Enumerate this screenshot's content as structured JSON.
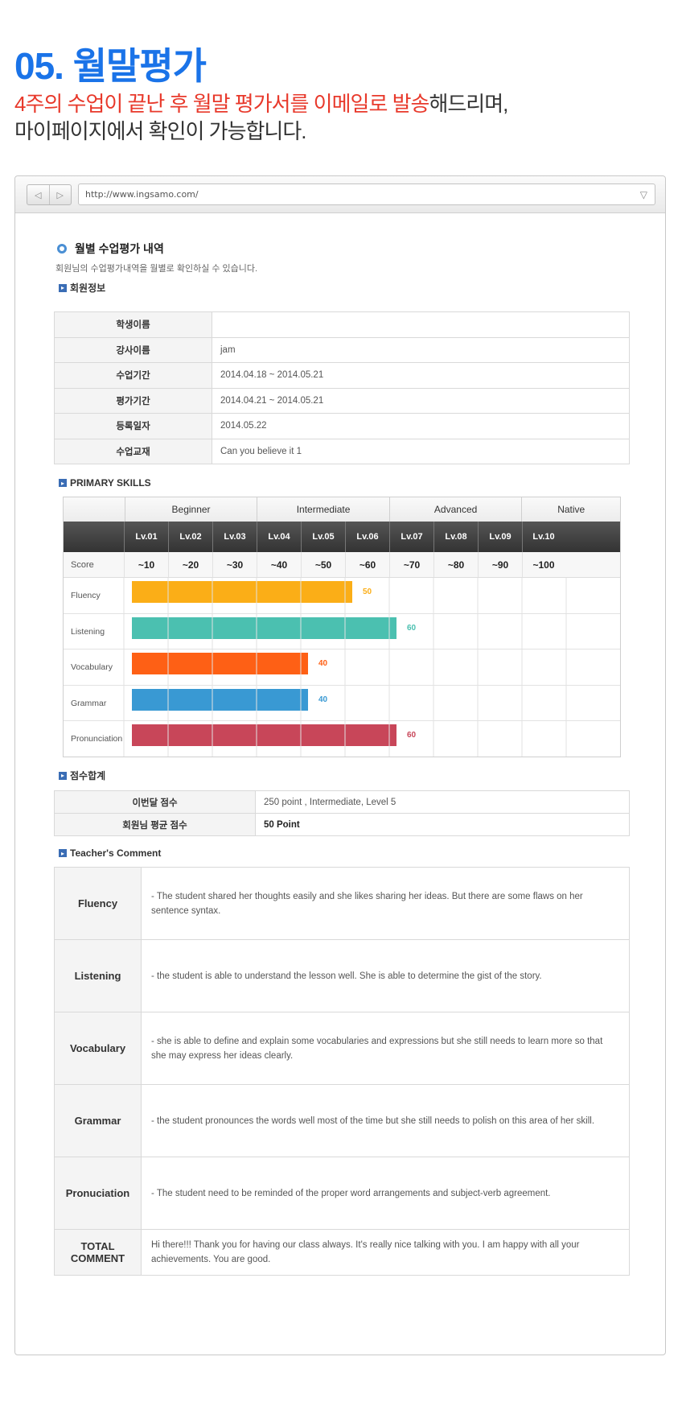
{
  "hero": {
    "title": "05. 월말평가",
    "sub_red": "4주의 수업이 끝난 후 월말 평가서를 이메일로 발송",
    "sub_black1": "해드리며,",
    "sub_black2": "마이페이지에서 확인이 가능합니다."
  },
  "browser": {
    "url": "http://www.ingsamo.com/",
    "back_icon": "◁",
    "forward_icon": "▷",
    "dropdown_icon": "▽"
  },
  "section": {
    "title": "월별 수업평가 내역",
    "desc": "회원님의 수업평가내역을 월별로 확인하실 수 있습니다."
  },
  "member": {
    "heading": "회원정보",
    "rows": [
      {
        "label": "학생이름",
        "value": ""
      },
      {
        "label": "강사이름",
        "value": "jam"
      },
      {
        "label": "수업기간",
        "value": "2014.04.18 ~ 2014.05.21"
      },
      {
        "label": "평가기간",
        "value": "2014.04.21 ~ 2014.05.21"
      },
      {
        "label": "등록일자",
        "value": "2014.05.22"
      },
      {
        "label": "수업교재",
        "value": " Can you believe it 1"
      }
    ]
  },
  "skills": {
    "heading": "PRIMARY SKILLS",
    "groups": [
      "Beginner",
      "Intermediate",
      "Advanced",
      "Native"
    ],
    "levels": [
      "Lv.01",
      "Lv.02",
      "Lv.03",
      "Lv.04",
      "Lv.05",
      "Lv.06",
      "Lv.07",
      "Lv.08",
      "Lv.09",
      "Lv.10"
    ],
    "score_label": "Score",
    "score_ticks": [
      "~10",
      "~20",
      "~30",
      "~40",
      "~50",
      "~60",
      "~70",
      "~80",
      "~90",
      "~100"
    ]
  },
  "chart_data": {
    "type": "bar",
    "orientation": "horizontal",
    "categories": [
      "Fluency",
      "Listening",
      "Vocabulary",
      "Grammar",
      "Pronunciation"
    ],
    "values": [
      50,
      60,
      40,
      40,
      60
    ],
    "value_labels": [
      "50",
      "60",
      "40",
      "40",
      "60"
    ],
    "colors": [
      "#fbae17",
      "#4bc0b0",
      "#fe6015",
      "#3999d3",
      "#c84659"
    ],
    "xlim": [
      0,
      100
    ],
    "grid": true
  },
  "totals": {
    "heading": "점수합계",
    "rows": [
      {
        "label": "이번달 점수",
        "value": "250 point , Intermediate, Level 5"
      },
      {
        "label": "회원님 평균 점수",
        "value": "50 Point"
      }
    ]
  },
  "comments": {
    "heading": "Teacher's Comment",
    "rows": [
      {
        "label": "Fluency",
        "text": "- The student shared her thoughts easily and she likes sharing her ideas. But there are some flaws on her sentence syntax."
      },
      {
        "label": "Listening",
        "text": "- the student is able to understand the lesson well. She is able to determine the gist of the story."
      },
      {
        "label": "Vocabulary",
        "text": "- she is able to define and explain some vocabularies and expressions but she still needs to learn more so that she may express her ideas clearly."
      },
      {
        "label": "Grammar",
        "text": "- the student pronounces the words well most of the time but she still needs to polish on this area of her skill."
      },
      {
        "label": "Pronuciation",
        "text": "- The student need to be reminded of the proper word arrangements and subject-verb agreement."
      },
      {
        "label": "TOTAL\nCOMMENT",
        "text": "Hi there!!! Thank you for having our class always. It's really nice talking with you. I am happy with all your achievements. You are good."
      }
    ]
  }
}
